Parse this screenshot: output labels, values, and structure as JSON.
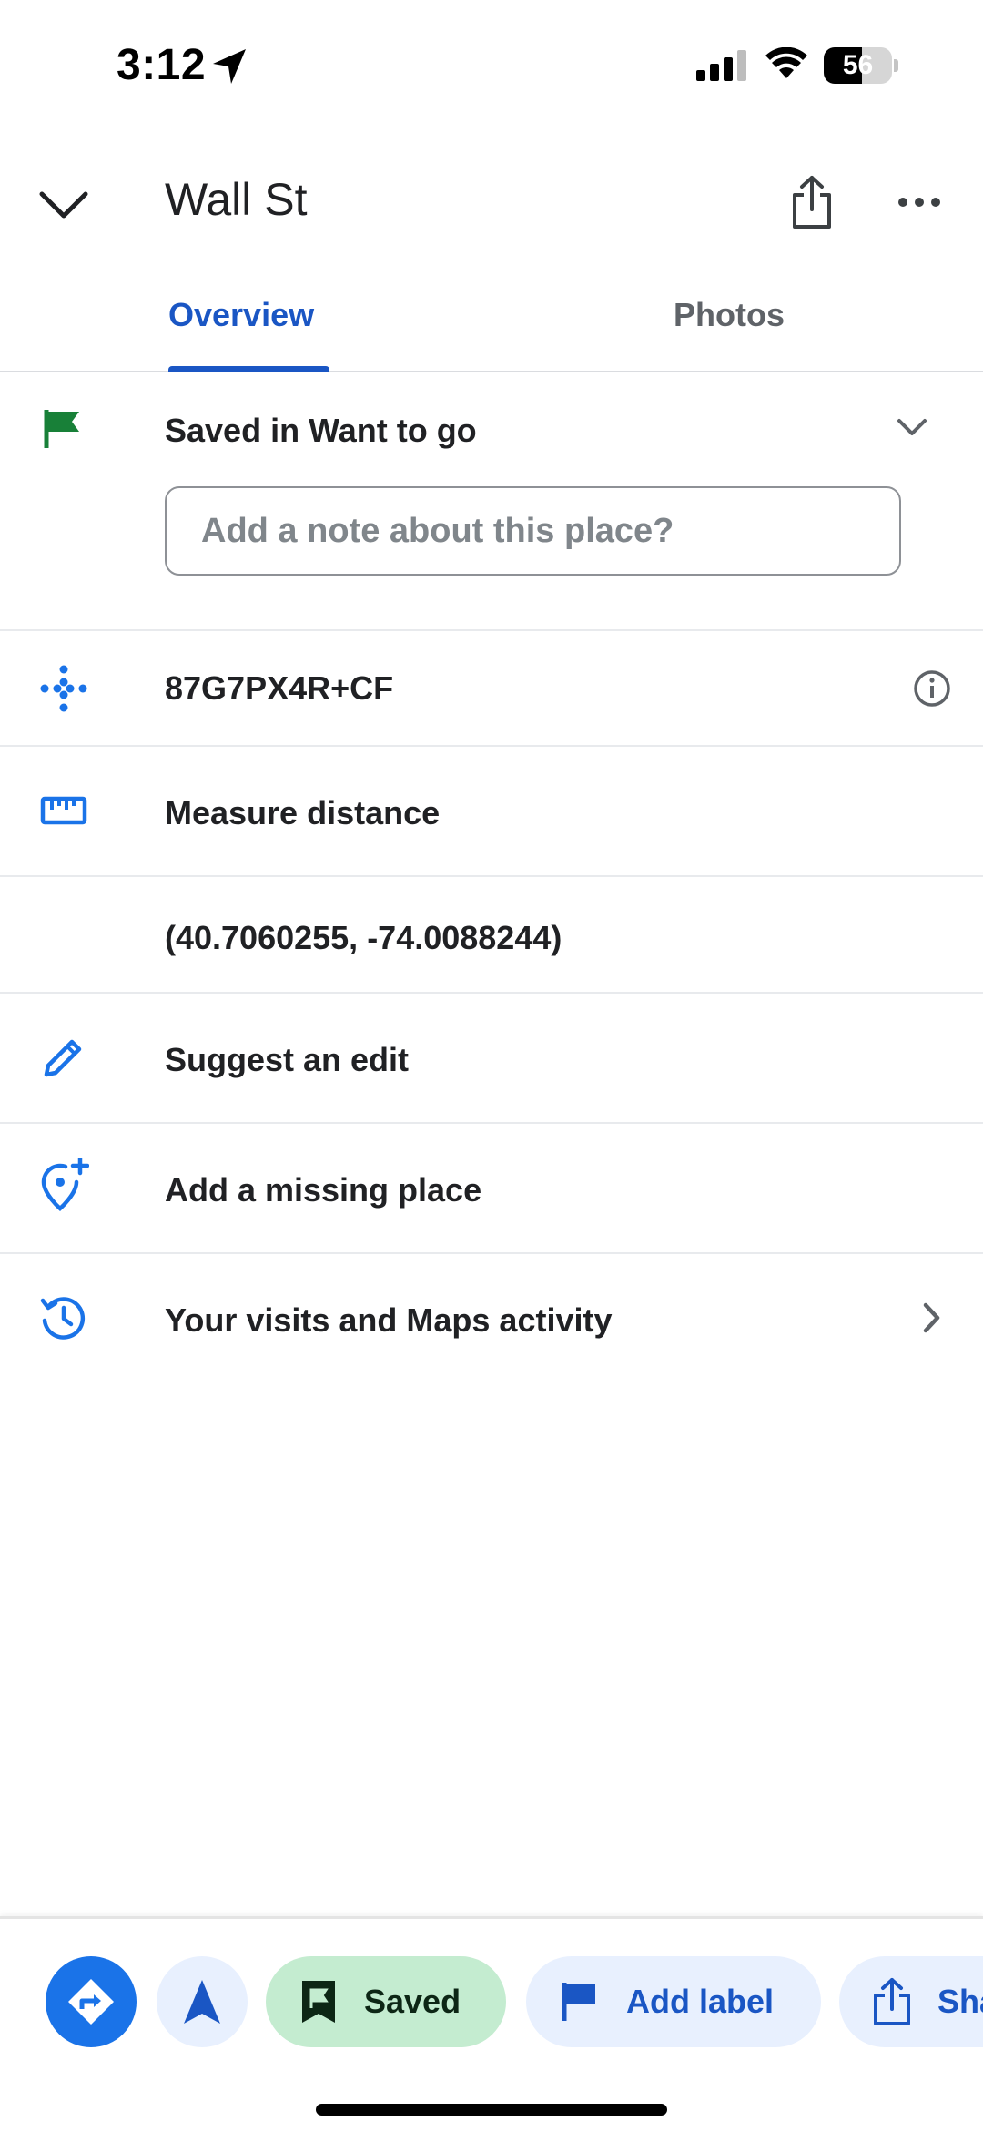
{
  "status_bar": {
    "time": "3:12",
    "battery_level": "56",
    "battery_fraction": 0.56,
    "icons": [
      "location-arrow-icon",
      "signal-icon",
      "wifi-icon",
      "battery-icon"
    ]
  },
  "header": {
    "title": "Wall St",
    "icons": [
      "chevron-down-icon",
      "share-icon",
      "more-icon"
    ]
  },
  "tabs": [
    {
      "label": "Overview",
      "active": true
    },
    {
      "label": "Photos",
      "active": false
    }
  ],
  "saved": {
    "label": "Saved in Want to go",
    "note_placeholder": "Add a note about this place?",
    "flag_color": "#188038"
  },
  "rows": [
    {
      "icon": "plus-code-icon",
      "text": "87G7PX4R+CF",
      "trailing": "info-icon"
    },
    {
      "icon": "ruler-icon",
      "text": "Measure distance"
    },
    {
      "icon": "",
      "text": "(40.7060255, -74.0088244)"
    },
    {
      "icon": "pencil-icon",
      "text": "Suggest an edit"
    },
    {
      "icon": "add-location-icon",
      "text": "Add a missing place"
    },
    {
      "icon": "history-icon",
      "text": "Your visits and Maps activity",
      "trailing": "chevron-right-icon"
    }
  ],
  "bottom_bar": {
    "directions_icon": "directions-icon",
    "start_icon": "navigation-icon",
    "saved_label": "Saved",
    "add_label_label": "Add label",
    "share_label": "Share"
  },
  "colors": {
    "accent": "#1a73e8",
    "accent_text": "#1a56c4",
    "saved_chip_bg": "#c4ecd0",
    "chip_bg": "#e8f0fe"
  }
}
